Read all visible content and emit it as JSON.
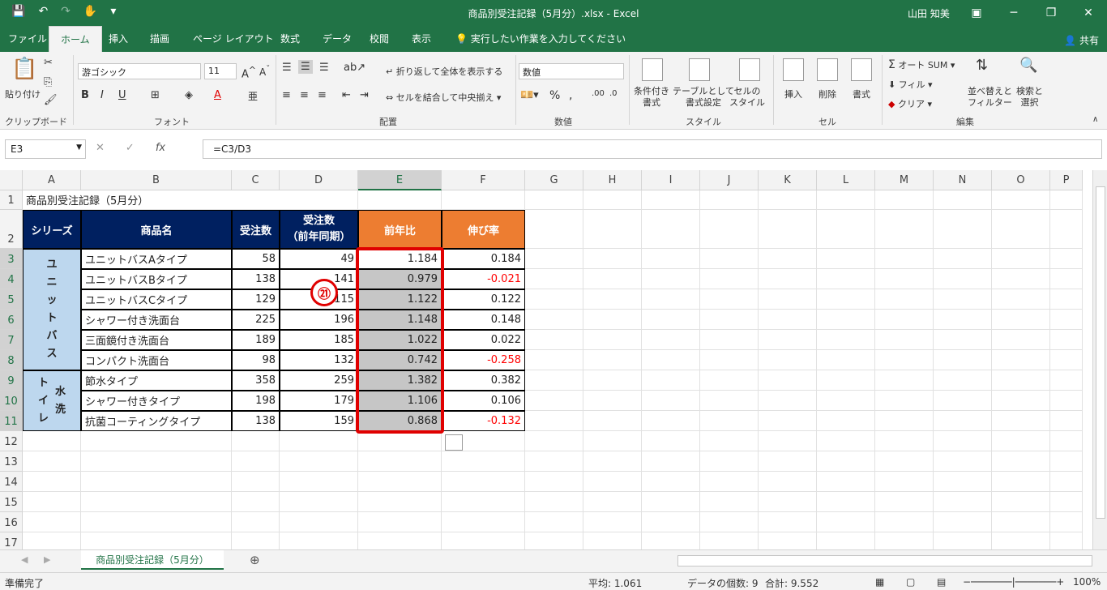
{
  "titlebar": {
    "title": "商品別受注記録（5月分）.xlsx  -  Excel",
    "user": "山田 知美"
  },
  "tabs": [
    "ファイル",
    "ホーム",
    "挿入",
    "描画",
    "ページ レイアウト",
    "数式",
    "データ",
    "校閲",
    "表示"
  ],
  "tell_me": "実行したい作業を入力してください",
  "share": "共有",
  "ribbon": {
    "paste": "貼り付け",
    "clipboard": "クリップボード",
    "font_name": "游ゴシック",
    "font_size": "11",
    "font_group": "フォント",
    "wrap_text": "折り返して全体を表示する",
    "merge_center": "セルを結合して中央揃え",
    "alignment": "配置",
    "number_format": "数値",
    "number_group": "数値",
    "cond_format": "条件付き\n書式",
    "cond_format_1": "条件付き",
    "cond_format_2": "書式",
    "table_format_1": "テーブルとして",
    "table_format_2": "書式設定",
    "cell_style_1": "セルの",
    "cell_style_2": "スタイル",
    "style_group": "スタイル",
    "insert": "挿入",
    "delete": "削除",
    "format": "書式",
    "cells_group": "セル",
    "autosum": "オート SUM",
    "fill": "フィル",
    "clear": "クリア",
    "sort_1": "並べ替えと",
    "sort_2": "フィルター",
    "find_1": "検索と",
    "find_2": "選択",
    "editing_group": "編集"
  },
  "formula_bar": {
    "name_box": "E3",
    "formula": "=C3/D3"
  },
  "columns": [
    "A",
    "B",
    "C",
    "D",
    "E",
    "F",
    "G",
    "H",
    "I",
    "J",
    "K",
    "L",
    "M",
    "N",
    "O",
    "P"
  ],
  "rows": [
    "1",
    "2",
    "3",
    "4",
    "5",
    "6",
    "7",
    "8",
    "9",
    "10",
    "11",
    "12",
    "13",
    "14",
    "15",
    "16",
    "17"
  ],
  "sheet": {
    "a1": "商品別受注記録（5月分）",
    "headers": {
      "series": "シリーズ",
      "product": "商品名",
      "orders": "受注数",
      "prev_1": "受注数",
      "prev_2": "（前年同期）",
      "yoy": "前年比",
      "growth": "伸び率"
    },
    "group1": [
      "ユ",
      "ニ",
      "ッ",
      "ト",
      "バ",
      "ス"
    ],
    "group2_col1": [
      "ト",
      "イ",
      "レ"
    ],
    "group2_col2": [
      "水",
      "洗"
    ],
    "data": [
      {
        "name": "ユニットバスAタイプ",
        "c": "58",
        "d": "49",
        "e": "1.184",
        "f": "0.184",
        "neg": false
      },
      {
        "name": "ユニットバスBタイプ",
        "c": "138",
        "d": "141",
        "e": "0.979",
        "f": "-0.021",
        "neg": true
      },
      {
        "name": "ユニットバスCタイプ",
        "c": "129",
        "d": "115",
        "e": "1.122",
        "f": "0.122",
        "neg": false
      },
      {
        "name": "シャワー付き洗面台",
        "c": "225",
        "d": "196",
        "e": "1.148",
        "f": "0.148",
        "neg": false
      },
      {
        "name": "三面鏡付き洗面台",
        "c": "189",
        "d": "185",
        "e": "1.022",
        "f": "0.022",
        "neg": false
      },
      {
        "name": "コンパクト洗面台",
        "c": "98",
        "d": "132",
        "e": "0.742",
        "f": "-0.258",
        "neg": true
      },
      {
        "name": "節水タイプ",
        "c": "358",
        "d": "259",
        "e": "1.382",
        "f": "0.382",
        "neg": false
      },
      {
        "name": "シャワー付きタイプ",
        "c": "198",
        "d": "179",
        "e": "1.106",
        "f": "0.106",
        "neg": false
      },
      {
        "name": "抗菌コーティングタイプ",
        "c": "138",
        "d": "159",
        "e": "0.868",
        "f": "-0.132",
        "neg": true
      }
    ]
  },
  "annotation": "㉑",
  "sheet_tab": "商品別受注記録（5月分）",
  "status": {
    "ready": "準備完了",
    "average": "平均: 1.061",
    "count": "データの個数: 9",
    "sum": "合計: 9.552",
    "zoom": "100%"
  },
  "colors": {
    "excel_green": "#217346",
    "navy": "#002060",
    "orange": "#ed7d31",
    "series_fill": "#bdd7ee",
    "highlight_red": "#e00000"
  }
}
